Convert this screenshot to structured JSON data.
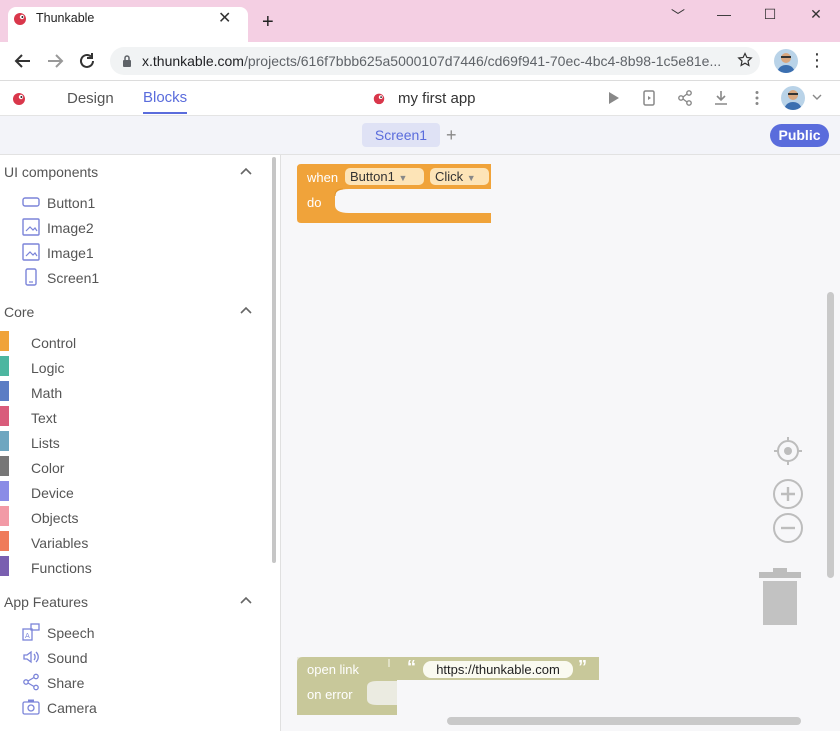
{
  "browser": {
    "tab_title": "Thunkable",
    "tab_close": "✕",
    "new_tab": "+",
    "url_host": "x.thunkable.com",
    "url_path": "/projects/616f7bbb625a5000107d7446/cd69f941-70ec-4bc4-8b98-1c5e81e...",
    "window_controls": [
      "﹀",
      "—",
      "☐",
      "✕"
    ],
    "menu": "⋮"
  },
  "header": {
    "tabs": [
      {
        "label": "Design",
        "active": false
      },
      {
        "label": "Blocks",
        "active": true
      }
    ],
    "project_name": "my first app",
    "accent": "#5a6cdc"
  },
  "screenbar": {
    "screen_tab": "Screen1",
    "add_screen": "+",
    "public_label": "Public"
  },
  "sidebar": {
    "ui_components": {
      "title": "UI components",
      "items": [
        {
          "label": "Button1",
          "icon": "button-icon"
        },
        {
          "label": "Image2",
          "icon": "image-icon"
        },
        {
          "label": "Image1",
          "icon": "image-icon"
        },
        {
          "label": "Screen1",
          "icon": "screen-icon"
        }
      ]
    },
    "core": {
      "title": "Core",
      "items": [
        {
          "label": "Control",
          "color": "#f0a33a"
        },
        {
          "label": "Logic",
          "color": "#4db6a0"
        },
        {
          "label": "Math",
          "color": "#5b7dc4"
        },
        {
          "label": "Text",
          "color": "#d95c7b"
        },
        {
          "label": "Lists",
          "color": "#6ea6c0"
        },
        {
          "label": "Color",
          "color": "#777777"
        },
        {
          "label": "Device",
          "color": "#8a8ce6"
        },
        {
          "label": "Objects",
          "color": "#f29aa6"
        },
        {
          "label": "Variables",
          "color": "#ef7b5a"
        },
        {
          "label": "Functions",
          "color": "#7a5fb0"
        }
      ]
    },
    "app_features": {
      "title": "App Features",
      "items": [
        {
          "label": "Speech",
          "icon": "speech-icon"
        },
        {
          "label": "Sound",
          "icon": "sound-icon"
        },
        {
          "label": "Share",
          "icon": "share-icon"
        },
        {
          "label": "Camera",
          "icon": "camera-icon"
        }
      ]
    }
  },
  "workspace": {
    "event_block": {
      "when": "when",
      "component": "Button1",
      "event": "Click",
      "do": "do",
      "color": "#f0a33a"
    },
    "open_link_block": {
      "label": "open link",
      "url": "https://thunkable.com",
      "on_error": "on error",
      "color": "#c8c89a"
    }
  }
}
